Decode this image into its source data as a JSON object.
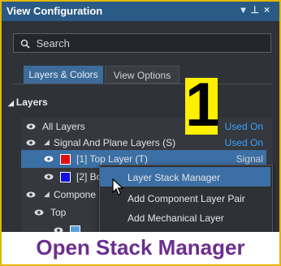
{
  "panel": {
    "title": "View Configuration",
    "title_icons": {
      "menu": "chevron-down-icon",
      "pin": "pin-icon",
      "close": "close-icon"
    }
  },
  "search": {
    "placeholder": "Search"
  },
  "tabs": [
    {
      "label": "Layers & Colors",
      "active": true
    },
    {
      "label": "View Options",
      "active": false
    }
  ],
  "section": {
    "label": "Layers"
  },
  "list": {
    "all_layers": {
      "label": "All Layers",
      "right": "Used On"
    },
    "signal_plane": {
      "label": "Signal And Plane Layers (S)",
      "right": "Used On"
    },
    "top_layer": {
      "label": "[1] Top Layer (T)",
      "right": "Signal",
      "color": "#e01010"
    },
    "bottom_layer": {
      "label": "[2] Bo",
      "color": "#1010e0"
    },
    "component": {
      "label": "Compone"
    },
    "top": {
      "label": "Top"
    },
    "sub_swatch_color": "#5aa0dc"
  },
  "context_menu": [
    "Layer Stack Manager",
    "Add Component Layer Pair",
    "Add Mechanical Layer"
  ],
  "step_badge": "1",
  "caption": "Open Stack Manager",
  "colors": {
    "accent": "#2a5a86",
    "badge": "#ffef00",
    "caption": "#6b2e8e",
    "border": "#e3b600"
  }
}
